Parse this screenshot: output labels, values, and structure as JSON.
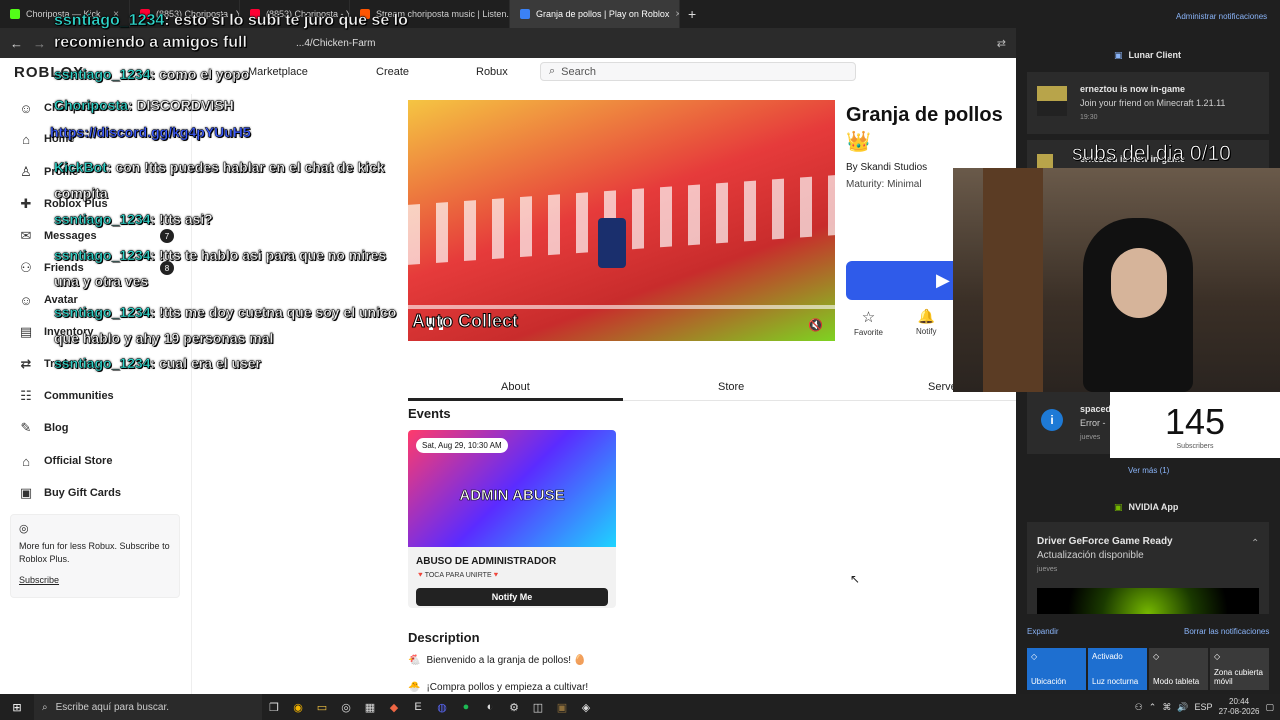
{
  "browser": {
    "tabs": [
      {
        "label": "Choriposta — Kick",
        "color": "#53fc18",
        "active": false
      },
      {
        "label": "(8853) Choriposta - YouTube",
        "color": "#ff0033",
        "active": false
      },
      {
        "label": "(8853) Choriposta - YouTube",
        "color": "#ff0033",
        "active": false
      },
      {
        "label": "Stream choriposta music | Listen...",
        "color": "#ff5500",
        "active": false
      },
      {
        "label": "Granja de pollos | Play on Roblox",
        "color": "#3b82f6",
        "active": true
      }
    ],
    "address": "...4/Chicken-Farm",
    "new_tab": "+"
  },
  "roblox": {
    "logo": "ROBLOX",
    "nav": {
      "marketplace": "Marketplace",
      "create": "Create",
      "robux": "Robux"
    },
    "search_placeholder": "Search",
    "sidebar": [
      {
        "label": "Choriposta",
        "icon": "avatar"
      },
      {
        "label": "Home",
        "icon": "home"
      },
      {
        "label": "Profile",
        "icon": "person"
      },
      {
        "label": "Roblox Plus",
        "icon": "plus"
      },
      {
        "label": "Messages",
        "icon": "chat",
        "badge": "7"
      },
      {
        "label": "Friends",
        "icon": "friends",
        "badge": "8"
      },
      {
        "label": "Avatar",
        "icon": "avatar"
      },
      {
        "label": "Inventory",
        "icon": "box"
      },
      {
        "label": "Trade",
        "icon": "trade"
      },
      {
        "label": "Communities",
        "icon": "group"
      },
      {
        "label": "Blog",
        "icon": "blog"
      },
      {
        "label": "Official Store",
        "icon": "store"
      },
      {
        "label": "Buy Gift Cards",
        "icon": "gift"
      }
    ],
    "plus_card": {
      "text": "More fun for less Robux. Subscribe to Roblox Plus.",
      "link": "Subscribe"
    },
    "game": {
      "title": "Granja de pollos",
      "emoji": "👑",
      "by": "By Skandi Studios",
      "maturity": "Maturity: Minimal",
      "hero_text": "Auto Collect",
      "favorite": "Favorite",
      "notify": "Notify"
    },
    "tabs": {
      "about": "About",
      "store": "Store",
      "servers": "Servers"
    },
    "events_title": "Events",
    "event": {
      "date": "Sat, Aug 29, 10:30 AM",
      "banner": "ADMIN ABUSE",
      "name": "ABUSO DE ADMINISTRADOR",
      "sub": "🔻TOCA PARA UNIRTE🔻",
      "button": "Notify Me"
    },
    "description_title": "Description",
    "description": [
      "Bienvenido a la granja de pollos! 🥚",
      "¡Compra pollos y empieza a cultivar!"
    ]
  },
  "chat": [
    {
      "user": "ssntiago_1234",
      "msg": ": esto si lo subi te juro que se lo recomiendo a amigos full",
      "big": true
    },
    {
      "user": "ssntiago_1234",
      "msg": ": como el yopo"
    },
    {
      "user": "Choriposta",
      "msg": ": DISCORDVISH"
    },
    {
      "user": "",
      "msg": "https://discord.gg/kg4pYUuH5"
    },
    {
      "user": "KickBot",
      "msg": ": con !tts puedes hablar en el chat de kick compita"
    },
    {
      "user": "ssntiago_1234",
      "msg": ": !tts asi?"
    },
    {
      "user": "ssntiago_1234",
      "msg": ": !tts te hablo asi para que no mires una y otra ves"
    },
    {
      "user": "ssntiago_1234",
      "msg": ": !tts me doy cuetna que soy el unico que hablo y ahy 19 personas mal"
    },
    {
      "user": "ssntiago_1234",
      "msg": ": cual era el user"
    }
  ],
  "notifications": {
    "manage": "Administrar notificaciones",
    "group1": "Lunar Client",
    "card1": {
      "title": "erneztou is now in-game",
      "body": "Join your friend on Minecraft 1.21.11",
      "time": "19:30"
    },
    "card2": {
      "title": "erneztou is now in-game"
    },
    "card3": {
      "title": "spaced",
      "body": "Error -",
      "time": "jueves"
    },
    "see_more": "Ver más (1)",
    "group2": "NVIDIA App",
    "card4": {
      "title": "Driver GeForce Game Ready",
      "body": "Actualización disponible",
      "time": "jueves"
    },
    "expand": "Expandir",
    "clear": "Borrar las notificaciones",
    "quick": [
      {
        "label": "Ubicación",
        "active": true
      },
      {
        "label": "Luz nocturna",
        "active": true,
        "top": "Activado"
      },
      {
        "label": "Modo tableta",
        "active": false
      },
      {
        "label": "Zona cubierta móvil",
        "active": false
      }
    ]
  },
  "stream": {
    "subs_goal": "subs del dia 0/10",
    "subscribers_count": "145",
    "subscribers_label": "Subscribers"
  },
  "taskbar": {
    "search_placeholder": "Escribe aquí para buscar.",
    "lang": "ESP",
    "time": "20:44",
    "date": "27-08-2026"
  }
}
